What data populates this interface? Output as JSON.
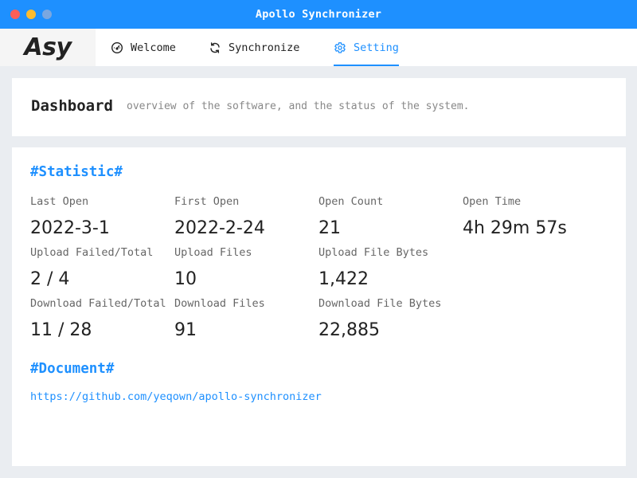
{
  "window": {
    "title": "Apollo Synchronizer"
  },
  "logo": "Asy",
  "tabs": [
    {
      "label": "Welcome",
      "icon": "dashboard-icon"
    },
    {
      "label": "Synchronize",
      "icon": "sync-icon"
    },
    {
      "label": "Setting",
      "icon": "gear-icon",
      "active": true
    }
  ],
  "dashboard": {
    "title": "Dashboard",
    "subtitle": "overview of the software, and the status of the system."
  },
  "statistic": {
    "heading": "#Statistic#",
    "items": [
      {
        "label": "Last Open",
        "value": "2022-3-1"
      },
      {
        "label": "First Open",
        "value": "2022-2-24"
      },
      {
        "label": "Open Count",
        "value": "21"
      },
      {
        "label": "Open Time",
        "value": "4h 29m 57s"
      },
      {
        "label": "Upload Failed/Total",
        "value": "2 / 4"
      },
      {
        "label": "Upload Files",
        "value": "10"
      },
      {
        "label": "Upload File Bytes",
        "value": "1,422"
      },
      {
        "label": "Download Failed/Total",
        "value": "11 / 28"
      },
      {
        "label": "Download Files",
        "value": "91"
      },
      {
        "label": "Download File Bytes",
        "value": "22,885"
      }
    ]
  },
  "document": {
    "heading": "#Document#",
    "link": "https://github.com/yeqown/apollo-synchronizer"
  },
  "colors": {
    "accent": "#1e90ff",
    "background": "#eaedf1"
  }
}
